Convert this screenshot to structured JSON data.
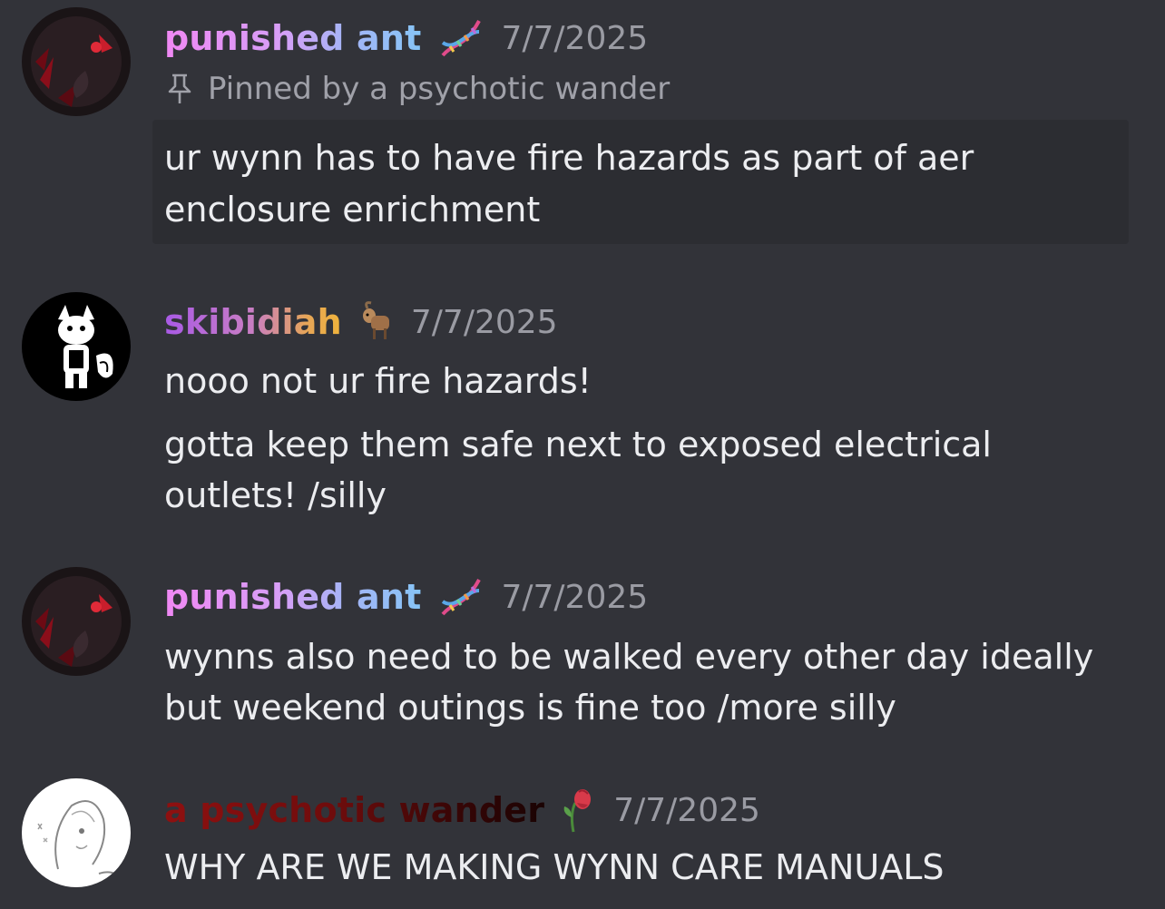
{
  "messages": [
    {
      "author": "punished ant",
      "badge": "dna-emoji",
      "timestamp": "7/7/2025",
      "pinned_label": "Pinned by a psychotic wander",
      "lines": [
        "ur wynn has to have fire hazards as part of aer",
        "enclosure enrichment"
      ]
    },
    {
      "author": "skibidiah",
      "badge": "goat-emoji",
      "timestamp": "7/7/2025",
      "lines": [
        "nooo not ur fire hazards!"
      ],
      "followup_lines": [
        "gotta keep them safe next to exposed electrical",
        "outlets! /silly"
      ]
    },
    {
      "author": "punished ant",
      "badge": "dna-emoji",
      "timestamp": "7/7/2025",
      "lines": [
        "wynns also need to be walked every other day ideally",
        "but weekend outings is fine too /more silly"
      ]
    },
    {
      "author": "a psychotic wander",
      "badge": "wilted-rose-emoji",
      "timestamp": "7/7/2025",
      "lines": [
        "WHY ARE WE MAKING WYNN CARE MANUALS"
      ]
    }
  ],
  "colors": {
    "background": "#323339",
    "pinned_background": "#2c2d32",
    "text": "#ecedf0",
    "muted": "#9a9ba3"
  }
}
